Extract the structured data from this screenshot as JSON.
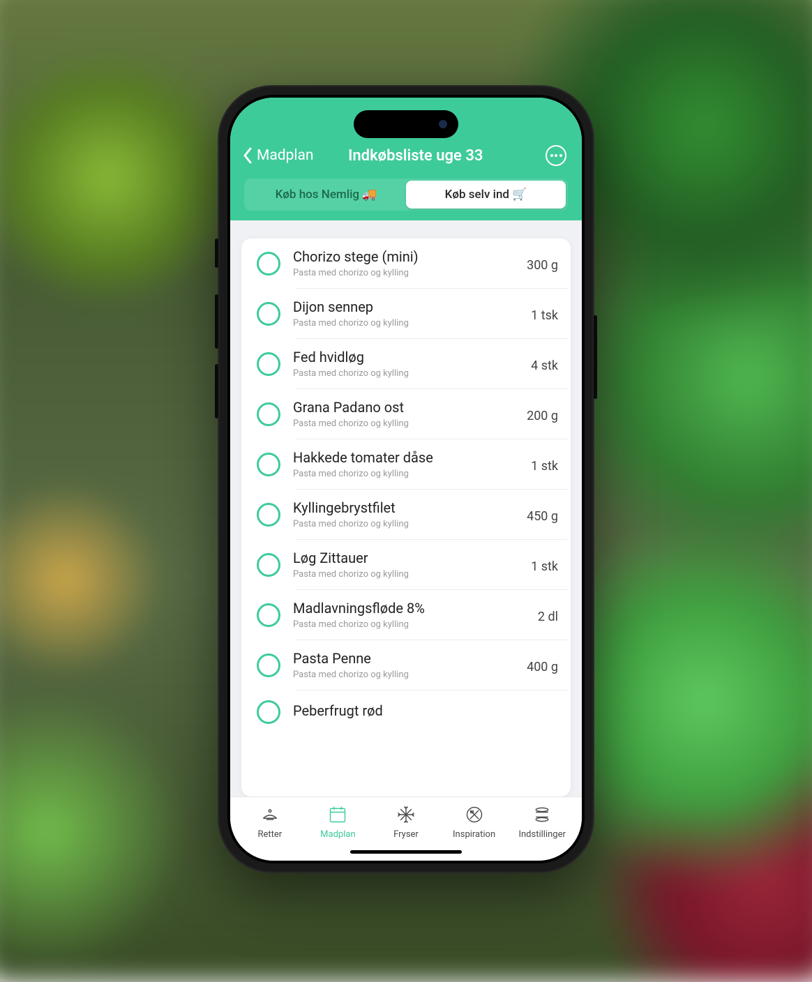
{
  "header": {
    "back_label": "Madplan",
    "title": "Indkøbsliste uge 33"
  },
  "segments": {
    "nemlig": "Køb hos Nemlig 🚚",
    "self": "Køb selv ind 🛒"
  },
  "items": [
    {
      "name": "Chorizo stege (mini)",
      "sub": "Pasta med chorizo og kylling",
      "qty": "300 g"
    },
    {
      "name": "Dijon sennep",
      "sub": "Pasta med chorizo og kylling",
      "qty": "1 tsk"
    },
    {
      "name": "Fed hvidløg",
      "sub": "Pasta med chorizo og kylling",
      "qty": "4 stk"
    },
    {
      "name": "Grana Padano ost",
      "sub": "Pasta med chorizo og kylling",
      "qty": "200 g"
    },
    {
      "name": "Hakkede tomater dåse",
      "sub": "Pasta med chorizo og kylling",
      "qty": "1 stk"
    },
    {
      "name": "Kyllingebrystfilet",
      "sub": "Pasta med chorizo og kylling",
      "qty": "450 g"
    },
    {
      "name": "Løg Zittauer",
      "sub": "Pasta med chorizo og kylling",
      "qty": "1 stk"
    },
    {
      "name": "Madlavningsfløde 8%",
      "sub": "Pasta med chorizo og kylling",
      "qty": "2 dl"
    },
    {
      "name": "Pasta Penne",
      "sub": "Pasta med chorizo og kylling",
      "qty": "400 g"
    }
  ],
  "peek_item": {
    "name": "Peberfrugt rød"
  },
  "tabs": [
    {
      "id": "retter",
      "label": "Retter"
    },
    {
      "id": "madplan",
      "label": "Madplan"
    },
    {
      "id": "fryser",
      "label": "Fryser"
    },
    {
      "id": "inspiration",
      "label": "Inspiration"
    },
    {
      "id": "indstillinger",
      "label": "Indstillinger"
    }
  ],
  "active_tab": "madplan"
}
